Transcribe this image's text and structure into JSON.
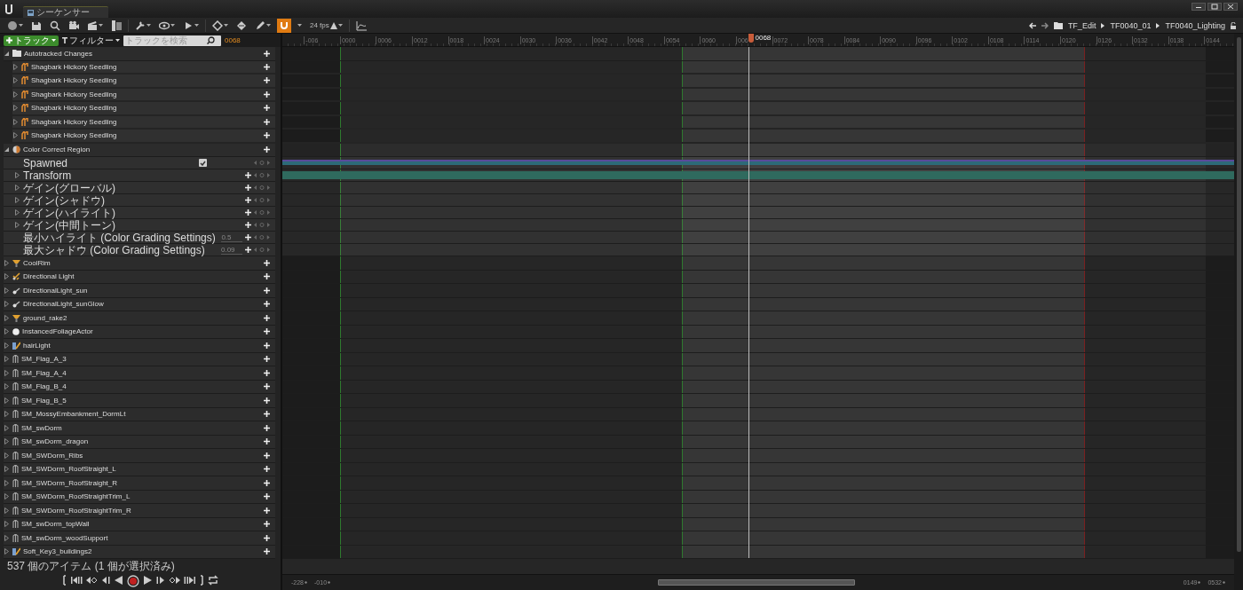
{
  "tab": {
    "title": "シーケンサー",
    "selected": true
  },
  "toolbar": {
    "fps": "24 fps",
    "snap_enabled": true
  },
  "breadcrumb": [
    "TF_Edit",
    "TF0040_01",
    "TF0040_Lighting"
  ],
  "track_bar": {
    "add_track": "トラック",
    "filter": "フィルター",
    "search_placeholder": "トラックを検索",
    "current_frame": "0068"
  },
  "tracks": [
    {
      "kind": "folder",
      "label": "Autotracked Changes",
      "expanded": true,
      "children": [
        {
          "kind": "foliage",
          "label": "Shagbark  Hickory Seedling",
          "expanded": false
        },
        {
          "kind": "foliage",
          "label": "Shagbark  Hickory Seedling",
          "expanded": false
        },
        {
          "kind": "foliage",
          "label": "Shagbark  Hickory Seedling",
          "expanded": false
        },
        {
          "kind": "foliage",
          "label": "Shagbark  Hickory Seedling",
          "expanded": false
        },
        {
          "kind": "foliage",
          "label": "Shagbark  Hickory Seedling",
          "expanded": false
        },
        {
          "kind": "foliage",
          "label": "Shagbark  Hickory Seedling",
          "expanded": false
        }
      ]
    },
    {
      "kind": "region",
      "label": "Color Correct Region",
      "expanded": true,
      "children": [
        {
          "kind": "bool",
          "label": "Spawned",
          "checked": true,
          "section": true
        },
        {
          "kind": "group",
          "label": "Transform",
          "expanded": false,
          "section": true
        },
        {
          "kind": "group",
          "label": "ゲイン(グローバル)",
          "expanded": false,
          "section": false
        },
        {
          "kind": "group",
          "label": "ゲイン(シャドウ)",
          "expanded": false,
          "section": false
        },
        {
          "kind": "group",
          "label": "ゲイン(ハイライト)",
          "expanded": false,
          "section": false
        },
        {
          "kind": "group",
          "label": "ゲイン(中間トーン)",
          "expanded": false,
          "section": false
        },
        {
          "kind": "float",
          "label": "最小ハイライト (Color Grading Settings)",
          "value": "0.5",
          "section": false
        },
        {
          "kind": "float",
          "label": "最大シャドウ (Color Grading Settings)",
          "value": "0.09",
          "section": false
        }
      ]
    },
    {
      "kind": "rect_light",
      "label": "CoolRim",
      "expanded": false
    },
    {
      "kind": "spot_light",
      "label": "Directional Light",
      "expanded": false
    },
    {
      "kind": "dir_light",
      "label": "DirectionalLight_sun",
      "expanded": false
    },
    {
      "kind": "dir_light",
      "label": "DirectionalLight_sunGlow",
      "expanded": false
    },
    {
      "kind": "rect_light",
      "label": "ground_rake2",
      "expanded": false
    },
    {
      "kind": "sphere",
      "label": "InstancedFoliageActor",
      "expanded": false
    },
    {
      "kind": "multi",
      "label": "hairLight",
      "expanded": false
    },
    {
      "kind": "mesh",
      "label": "SM_Flag_A_3",
      "expanded": false
    },
    {
      "kind": "mesh",
      "label": "SM_Flag_A_4",
      "expanded": false
    },
    {
      "kind": "mesh",
      "label": "SM_Flag_B_4",
      "expanded": false
    },
    {
      "kind": "mesh",
      "label": "SM_Flag_B_5",
      "expanded": false
    },
    {
      "kind": "mesh",
      "label": "SM_MossyEmbankment_DormLt",
      "expanded": false
    },
    {
      "kind": "mesh",
      "label": "SM_swDorm",
      "expanded": false
    },
    {
      "kind": "mesh",
      "label": "SM_swDorm_dragon",
      "expanded": false
    },
    {
      "kind": "mesh",
      "label": "SM_SWDorm_Ribs",
      "expanded": false
    },
    {
      "kind": "mesh",
      "label": "SM_SWDorm_RoofStraight_L",
      "expanded": false
    },
    {
      "kind": "mesh",
      "label": "SM_SWDorm_RoofStraight_R",
      "expanded": false
    },
    {
      "kind": "mesh",
      "label": "SM_SWDorm_RoofStraightTrim_L",
      "expanded": false
    },
    {
      "kind": "mesh",
      "label": "SM_SWDorm_RoofStraightTrim_R",
      "expanded": false
    },
    {
      "kind": "mesh",
      "label": "SM_swDorm_topWall",
      "expanded": false
    },
    {
      "kind": "mesh",
      "label": "SM_swDorm_woodSupport",
      "expanded": false
    },
    {
      "kind": "multi",
      "label": "Soft_Key3_buildings2",
      "expanded": false
    }
  ],
  "status": "537 個のアイテム (1 個が選択済み)",
  "ruler": {
    "ticks": [
      "-006",
      "0000",
      "0006",
      "0012",
      "0018",
      "0024",
      "0030",
      "0036",
      "0042",
      "0048",
      "0054",
      "0060",
      "006",
      "0072",
      "0078",
      "0084",
      "0090",
      "0096",
      "0102",
      "0108",
      "0114",
      "0120",
      "0126",
      "0132",
      "0138",
      "0144"
    ],
    "playhead": "0068"
  },
  "view_range": {
    "start": "-228",
    "view_start": "-010",
    "view_end": "0149",
    "end": "0532"
  }
}
